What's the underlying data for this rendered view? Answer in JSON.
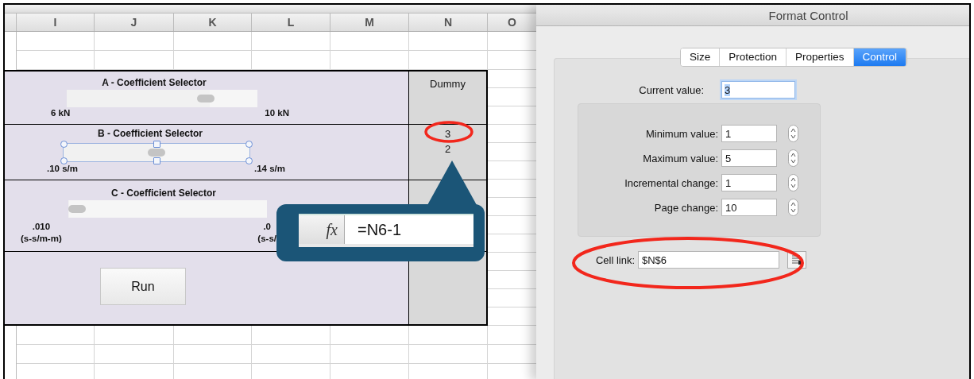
{
  "sheet": {
    "columns": [
      "I",
      "J",
      "K",
      "L",
      "M",
      "N",
      "O"
    ],
    "selectors": [
      {
        "title": "A - Coefficient Selector",
        "min_label": [
          "6 kN"
        ],
        "max_label": [
          "10 kN"
        ],
        "level": 0.75,
        "selected": false
      },
      {
        "title": "B - Coefficient Selector",
        "min_label": [
          ".10 s/m"
        ],
        "max_label": [
          ".14 s/m"
        ],
        "level": 0.5,
        "selected": true
      },
      {
        "title": "C - Coefficient Selector",
        "min_label": [
          ".010",
          "(s-s/m-m)"
        ],
        "max_label": [
          ".0",
          "(s-s/"
        ],
        "level": 0,
        "selected": false
      }
    ],
    "run_button": "Run",
    "dummy": {
      "header": "Dummy",
      "values": [
        "3",
        "2"
      ]
    }
  },
  "callout": {
    "function_label": "fx",
    "formula": "=N6-1"
  },
  "dialog": {
    "title": "Format Control",
    "tabs": [
      {
        "label": "Size",
        "selected": false
      },
      {
        "label": "Protection",
        "selected": false
      },
      {
        "label": "Properties",
        "selected": false
      },
      {
        "label": "Control",
        "selected": true
      }
    ],
    "current_value": {
      "label": "Current value:",
      "value": "3",
      "text_selected": true
    },
    "range_fields": [
      {
        "label": "Minimum value:",
        "value": "1"
      },
      {
        "label": "Maximum value:",
        "value": "5"
      },
      {
        "label": "Incremental change:",
        "value": "1"
      },
      {
        "label": "Page change:",
        "value": "10"
      }
    ],
    "cell_link": {
      "label": "Cell link:",
      "value": "$N$6"
    }
  }
}
